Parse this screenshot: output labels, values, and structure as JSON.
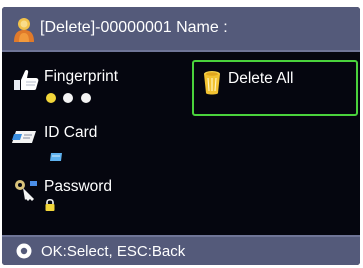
{
  "header": {
    "title": "[Delete]-00000001 Name :",
    "icon": "user-icon"
  },
  "menu": {
    "items": [
      {
        "id": "fingerprint",
        "label": "Fingerprint",
        "icon": "thumb-icon",
        "sub_icon": "fingerprint-dots"
      },
      {
        "id": "id_card",
        "label": "ID Card",
        "icon": "id-card-icon",
        "sub_icon": "card-indicator-icon"
      },
      {
        "id": "password",
        "label": "Password",
        "icon": "key-icon",
        "sub_icon": "lock-icon"
      },
      {
        "id": "delete_all",
        "label": "Delete All",
        "icon": "trash-can-icon",
        "selected": true
      }
    ],
    "fingerprint_dots": [
      "#f2d63a",
      "#f4f4f4",
      "#f4f4f4"
    ]
  },
  "footer": {
    "hint": "OK:Select, ESC:Back",
    "icon": "info-circle-icon"
  },
  "colors": {
    "bar_bg": "#545a7a",
    "screen_bg": "#05060f",
    "selection_border": "#4ad23c",
    "text": "#ffffff"
  }
}
